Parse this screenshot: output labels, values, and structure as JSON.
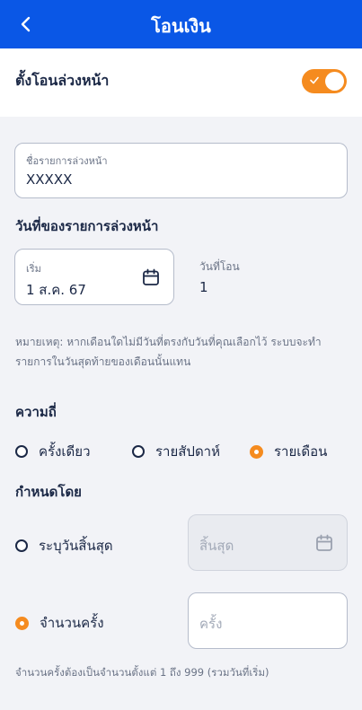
{
  "header": {
    "title": "โอนเงิน"
  },
  "schedule_toggle": {
    "label": "ตั้งโอนล่วงหน้า",
    "on": true
  },
  "schedule_name": {
    "label": "ชื่อรายการล่วงหน้า",
    "value": "XXXXX"
  },
  "date_section": {
    "title": "วันที่ของรายการล่วงหน้า",
    "start_label": "เริ่ม",
    "start_value": "1 ส.ค. 67",
    "transfer_day_label": "วันที่โอน",
    "transfer_day_value": "1"
  },
  "note": "หมายเหตุ: หากเดือนใดไม่มีวันที่ตรงกับวันที่คุณเลือกไว้ ระบบจะทำรายการในวันสุดท้ายของเดือนนั้นแทน",
  "frequency": {
    "title": "ความถี่",
    "options": [
      "ครั้งเดียว",
      "รายสัปดาห์",
      "รายเดือน"
    ],
    "selected": "รายเดือน"
  },
  "end_by": {
    "title": "กำหนดโดย",
    "end_date_option": "ระบุวันสิ้นสุด",
    "end_date_placeholder": "สิ้นสุด",
    "count_option": "จำนวนครั้ง",
    "count_placeholder": "ครั้ง",
    "selected": "จำนวนครั้ง",
    "hint": "จำนวนครั้งต้องเป็นจำนวนตั้งแต่ 1 ถึง 999 (รวมวันที่เริ่ม)"
  },
  "colors": {
    "header": "#0A57E6",
    "accent": "#F58B1F",
    "text": "#1B2846"
  }
}
